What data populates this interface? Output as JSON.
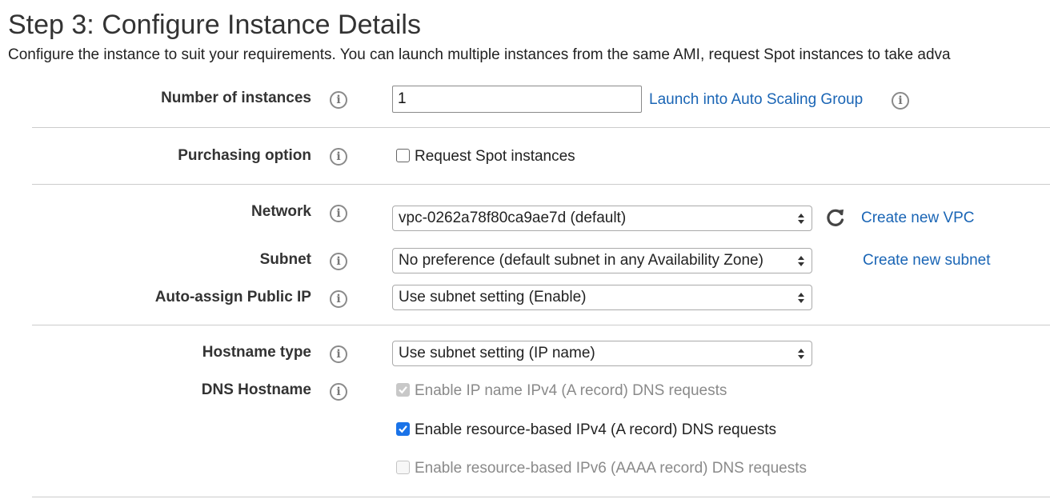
{
  "header": {
    "title": "Step 3: Configure Instance Details",
    "description": "Configure the instance to suit your requirements. You can launch multiple instances from the same AMI, request Spot instances to take adva"
  },
  "rows": {
    "instances": {
      "label": "Number of instances",
      "value": "1",
      "link": "Launch into Auto Scaling Group"
    },
    "purchasing": {
      "label": "Purchasing option",
      "checkbox_label": "Request Spot instances",
      "checked": false
    },
    "network": {
      "label": "Network",
      "selected": "vpc-0262a78f80ca9ae7d (default)",
      "link": "Create new VPC",
      "refresh_icon": "refresh-icon"
    },
    "subnet": {
      "label": "Subnet",
      "selected": "No preference (default subnet in any Availability Zone)",
      "link": "Create new subnet"
    },
    "public_ip": {
      "label": "Auto-assign Public IP",
      "selected": "Use subnet setting (Enable)"
    },
    "hostname_type": {
      "label": "Hostname type",
      "selected": "Use subnet setting (IP name)"
    },
    "dns_hostname": {
      "label": "DNS Hostname",
      "options": [
        {
          "label": "Enable IP name IPv4 (A record) DNS requests",
          "checked": true,
          "disabled": true
        },
        {
          "label": "Enable resource-based IPv4 (A record) DNS requests",
          "checked": true,
          "disabled": false
        },
        {
          "label": "Enable resource-based IPv6 (AAAA record) DNS requests",
          "checked": false,
          "disabled": true
        }
      ]
    }
  },
  "icons": {
    "info": "info-icon",
    "info_glyph": "i",
    "select_arrows": "select-arrows-icon",
    "checkmark": "checkmark-icon"
  },
  "colors": {
    "link": "#1a65b5",
    "checkbox_checked": "#1a73e8",
    "disabled_text": "#8a8a8a",
    "divider": "#cccccc"
  }
}
